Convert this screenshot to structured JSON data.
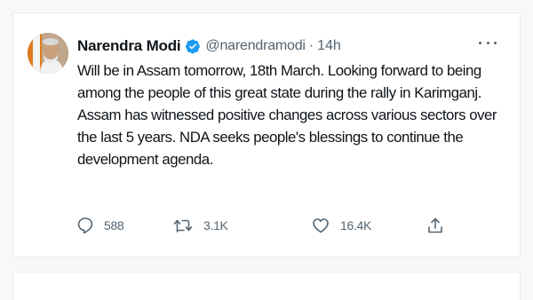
{
  "tweet": {
    "display_name": "Narendra Modi",
    "handle": "@narendramodi",
    "separator": "·",
    "time": "14h",
    "text": "Will be in Assam tomorrow, 18th March. Looking forward to being among the people of this great state during the rally in Karimganj. Assam has witnessed positive changes across various sectors over the last 5 years. NDA seeks people's blessings to continue the development agenda.",
    "verified_icon": "verified-badge-icon",
    "more_icon": "more-horizontal-icon"
  },
  "actions": {
    "reply": {
      "icon": "reply-icon",
      "count": "588"
    },
    "retweet": {
      "icon": "retweet-icon",
      "count": "3.1K"
    },
    "like": {
      "icon": "heart-icon",
      "count": "16.4K"
    },
    "share": {
      "icon": "share-icon"
    }
  },
  "colors": {
    "background": "#f7f9f9",
    "card": "#ffffff",
    "text": "#0f1419",
    "secondary": "#536471",
    "verified": "#1d9bf0"
  }
}
